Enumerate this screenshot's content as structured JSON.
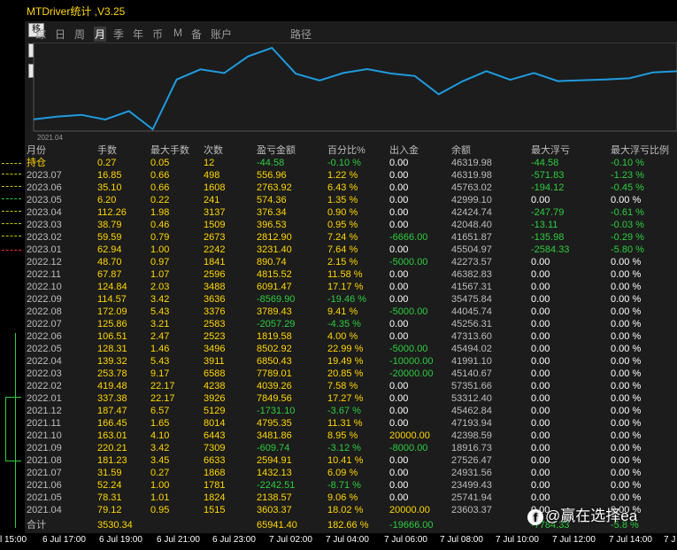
{
  "app": {
    "title": "MTDriver统计 ,V3.25"
  },
  "side_buttons": [
    "移",
    "√",
    "?"
  ],
  "tabs": [
    {
      "label": "综"
    },
    {
      "label": "日"
    },
    {
      "label": "周"
    },
    {
      "label": "月",
      "active": true
    },
    {
      "label": "季"
    },
    {
      "label": "年"
    },
    {
      "label": "币"
    },
    {
      "label": "M"
    },
    {
      "label": "备"
    },
    {
      "label": "账户"
    },
    {
      "label": "路径"
    }
  ],
  "chart": {
    "start_label": "2021.04",
    "line_color": "#1f9bde"
  },
  "chart_data": {
    "type": "line",
    "x_start": "2021.04",
    "series": [
      {
        "values": [
          23603.37,
          24931.56,
          25741.94,
          23499.43,
          27526.47,
          18916.73,
          42398.59,
          47193.94,
          45462.84,
          53312.4,
          57351.66,
          45140.67,
          41991.1,
          45494.02,
          47313.6,
          45256.31,
          44045.74,
          35475.84,
          41567.31,
          46382.83,
          42273.57,
          45504.97,
          41651.87,
          42048.4,
          42424.74,
          42999.1,
          45763.02,
          46319.98
        ]
      }
    ]
  },
  "table": {
    "headers": [
      "月份",
      "手数",
      "最大手数",
      "次数",
      "盈亏金额",
      "百分比%",
      "出入金",
      "余额",
      "最大浮亏",
      "最大浮亏比例"
    ],
    "rows": [
      [
        "持仓",
        "0.27",
        "0.05",
        "12",
        "-44.58",
        "-0.10 %",
        "0.00",
        "46319.98",
        "-44.58",
        "-0.10 %"
      ],
      [
        "2023.07",
        "16.85",
        "0.66",
        "498",
        "556.96",
        "1.22 %",
        "0.00",
        "46319.98",
        "-571.83",
        "-1.23 %"
      ],
      [
        "2023.06",
        "35.10",
        "0.66",
        "1608",
        "2763.92",
        "6.43 %",
        "0.00",
        "45763.02",
        "-194.12",
        "-0.45 %"
      ],
      [
        "2023.05",
        "6.20",
        "0.22",
        "241",
        "574.36",
        "1.35 %",
        "0.00",
        "42999.10",
        "0.00",
        "0.00 %"
      ],
      [
        "2023.04",
        "112.26",
        "1.98",
        "3137",
        "376.34",
        "0.90 %",
        "0.00",
        "42424.74",
        "-247.79",
        "-0.61 %"
      ],
      [
        "2023.03",
        "38.79",
        "0.46",
        "1509",
        "396.53",
        "0.95 %",
        "0.00",
        "42048.40",
        "-13.11",
        "-0.03 %"
      ],
      [
        "2023.02",
        "59.59",
        "0.79",
        "2673",
        "2812.90",
        "7.24 %",
        "-6666.00",
        "41651.87",
        "-135.98",
        "-0.29 %"
      ],
      [
        "2023.01",
        "62.94",
        "1.00",
        "2242",
        "3231.40",
        "7.64 %",
        "0.00",
        "45504.97",
        "-2584.33",
        "-5.80 %"
      ],
      [
        "2022.12",
        "48.70",
        "0.97",
        "1841",
        "890.74",
        "2.15 %",
        "-5000.00",
        "42273.57",
        "0.00",
        "0.00 %"
      ],
      [
        "2022.11",
        "67.87",
        "1.07",
        "2596",
        "4815.52",
        "11.58 %",
        "0.00",
        "46382.83",
        "0.00",
        "0.00 %"
      ],
      [
        "2022.10",
        "124.84",
        "2.03",
        "3488",
        "6091.47",
        "17.17 %",
        "0.00",
        "41567.31",
        "0.00",
        "0.00 %"
      ],
      [
        "2022.09",
        "114.57",
        "3.42",
        "3636",
        "-8569.90",
        "-19.46 %",
        "0.00",
        "35475.84",
        "0.00",
        "0.00 %"
      ],
      [
        "2022.08",
        "172.09",
        "5.43",
        "3376",
        "3789.43",
        "9.41 %",
        "-5000.00",
        "44045.74",
        "0.00",
        "0.00 %"
      ],
      [
        "2022.07",
        "125.86",
        "3.21",
        "2583",
        "-2057.29",
        "-4.35 %",
        "0.00",
        "45256.31",
        "0.00",
        "0.00 %"
      ],
      [
        "2022.06",
        "106.51",
        "2.47",
        "2523",
        "1819.58",
        "4.00 %",
        "0.00",
        "47313.60",
        "0.00",
        "0.00 %"
      ],
      [
        "2022.05",
        "128.31",
        "1.46",
        "3496",
        "8502.92",
        "22.99 %",
        "-5000.00",
        "45494.02",
        "0.00",
        "0.00 %"
      ],
      [
        "2022.04",
        "139.32",
        "5.43",
        "3911",
        "6850.43",
        "19.49 %",
        "-10000.00",
        "41991.10",
        "0.00",
        "0.00 %"
      ],
      [
        "2022.03",
        "253.78",
        "9.17",
        "6588",
        "7789.01",
        "20.85 %",
        "-20000.00",
        "45140.67",
        "0.00",
        "0.00 %"
      ],
      [
        "2022.02",
        "419.48",
        "22.17",
        "4238",
        "4039.26",
        "7.58 %",
        "0.00",
        "57351.66",
        "0.00",
        "0.00 %"
      ],
      [
        "2022.01",
        "337.38",
        "22.17",
        "3926",
        "7849.56",
        "17.27 %",
        "0.00",
        "53312.40",
        "0.00",
        "0.00 %"
      ],
      [
        "2021.12",
        "187.47",
        "6.57",
        "5129",
        "-1731.10",
        "-3.67 %",
        "0.00",
        "45462.84",
        "0.00",
        "0.00 %"
      ],
      [
        "2021.11",
        "166.45",
        "1.65",
        "8014",
        "4795.35",
        "11.31 %",
        "0.00",
        "47193.94",
        "0.00",
        "0.00 %"
      ],
      [
        "2021.10",
        "163.01",
        "4.10",
        "6443",
        "3481.86",
        "8.95 %",
        "20000.00",
        "42398.59",
        "0.00",
        "0.00 %"
      ],
      [
        "2021.09",
        "220.21",
        "3.42",
        "7309",
        "-609.74",
        "-3.12 %",
        "-8000.00",
        "18916.73",
        "0.00",
        "0.00 %"
      ],
      [
        "2021.08",
        "181.23",
        "3.45",
        "6633",
        "2594.91",
        "10.41 %",
        "0.00",
        "27526.47",
        "0.00",
        "0.00 %"
      ],
      [
        "2021.07",
        "31.59",
        "0.27",
        "1868",
        "1432.13",
        "6.09 %",
        "0.00",
        "24931.56",
        "0.00",
        "0.00 %"
      ],
      [
        "2021.06",
        "52.24",
        "1.00",
        "1781",
        "-2242.51",
        "-8.71 %",
        "0.00",
        "23499.43",
        "0.00",
        "0.00 %"
      ],
      [
        "2021.05",
        "78.31",
        "1.01",
        "1824",
        "2138.57",
        "9.06 %",
        "0.00",
        "25741.94",
        "0.00",
        "0.00 %"
      ],
      [
        "2021.04",
        "79.12",
        "0.95",
        "1515",
        "3603.37",
        "18.02 %",
        "20000.00",
        "23603.37",
        "0.00",
        "0.00 %"
      ]
    ],
    "total": [
      "合计",
      "3530.34",
      "",
      "",
      "65941.40",
      "182.66 %",
      "-19666.00",
      "",
      "-7784.33",
      "-5.8 %"
    ]
  },
  "x_axis": [
    "l 15:00",
    "6 Jul 17:00",
    "6 Jul 19:00",
    "6 Jul 21:00",
    "6 Jul 23:00",
    "7 Jul 02:00",
    "7 Jul 04:00",
    "7 Jul 06:00",
    "7 Jul 08:00",
    "7 Jul 10:00",
    "7 Jul 12:00",
    "7 Jul 14:00",
    "7 J"
  ],
  "watermark": {
    "icon": "facebook-icon",
    "text": "@赢在选择ea"
  },
  "colors": {
    "positive": "#ffd700",
    "negative": "#2ecc40",
    "neutral": "#ffffff",
    "line": "#1f9bde"
  }
}
